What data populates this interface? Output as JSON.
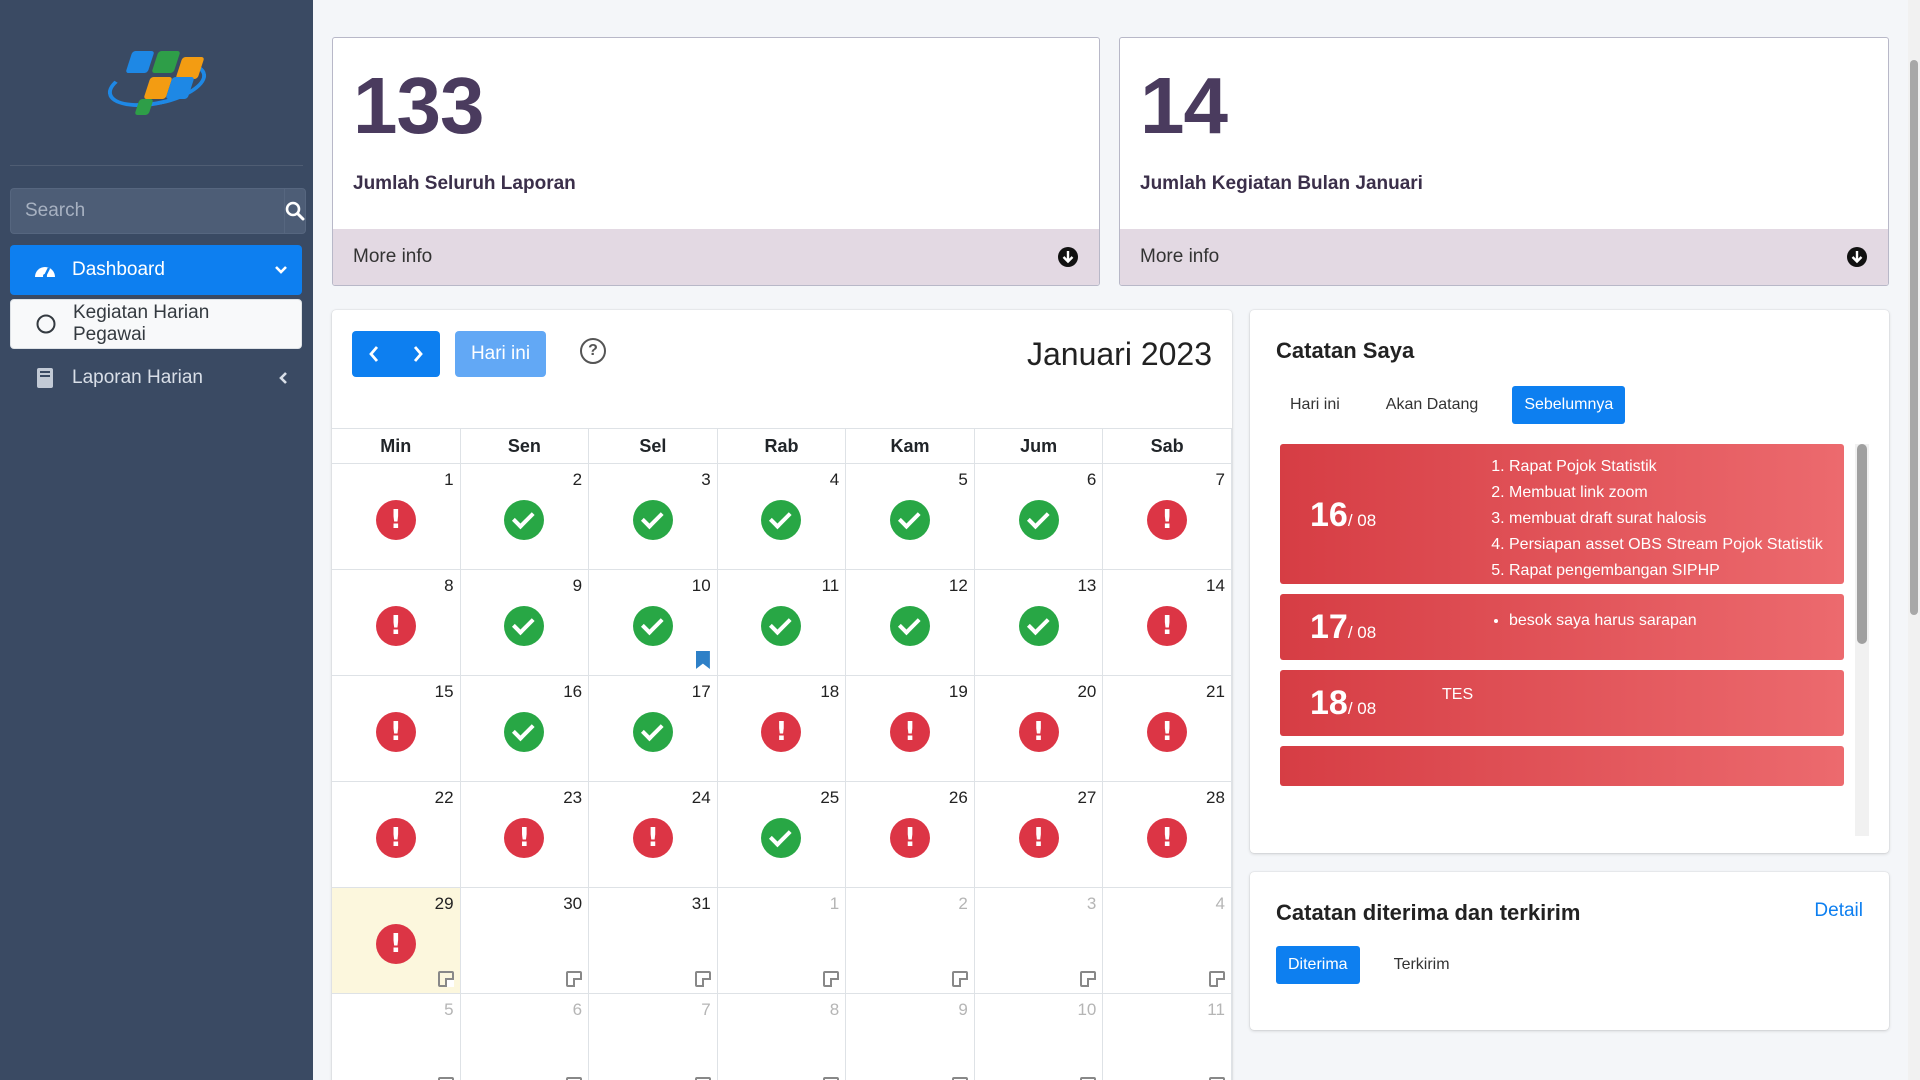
{
  "sidebar": {
    "search_placeholder": "Search",
    "items": [
      {
        "label": "Dashboard",
        "icon": "tachometer-icon"
      },
      {
        "label": "Kegiatan Harian Pegawai",
        "icon": "circle-icon"
      },
      {
        "label": "Laporan Harian",
        "icon": "book-icon"
      }
    ]
  },
  "info_boxes": [
    {
      "number": "133",
      "label": "Jumlah Seluruh Laporan",
      "more": "More info"
    },
    {
      "number": "14",
      "label": "Jumlah Kegiatan Bulan Januari",
      "more": "More info"
    }
  ],
  "calendar": {
    "title": "Januari 2023",
    "today_label": "Hari ini",
    "days": [
      "Min",
      "Sen",
      "Sel",
      "Rab",
      "Kam",
      "Jum",
      "Sab"
    ],
    "weeks": [
      [
        {
          "d": "1",
          "s": "bad"
        },
        {
          "d": "2",
          "s": "ok"
        },
        {
          "d": "3",
          "s": "ok"
        },
        {
          "d": "4",
          "s": "ok"
        },
        {
          "d": "5",
          "s": "ok"
        },
        {
          "d": "6",
          "s": "ok"
        },
        {
          "d": "7",
          "s": "bad"
        }
      ],
      [
        {
          "d": "8",
          "s": "bad"
        },
        {
          "d": "9",
          "s": "ok"
        },
        {
          "d": "10",
          "s": "ok",
          "bookmark": true
        },
        {
          "d": "11",
          "s": "ok"
        },
        {
          "d": "12",
          "s": "ok"
        },
        {
          "d": "13",
          "s": "ok"
        },
        {
          "d": "14",
          "s": "bad"
        }
      ],
      [
        {
          "d": "15",
          "s": "bad"
        },
        {
          "d": "16",
          "s": "ok"
        },
        {
          "d": "17",
          "s": "ok"
        },
        {
          "d": "18",
          "s": "bad"
        },
        {
          "d": "19",
          "s": "bad"
        },
        {
          "d": "20",
          "s": "bad"
        },
        {
          "d": "21",
          "s": "bad"
        }
      ],
      [
        {
          "d": "22",
          "s": "bad"
        },
        {
          "d": "23",
          "s": "bad"
        },
        {
          "d": "24",
          "s": "bad"
        },
        {
          "d": "25",
          "s": "ok"
        },
        {
          "d": "26",
          "s": "bad"
        },
        {
          "d": "27",
          "s": "bad"
        },
        {
          "d": "28",
          "s": "bad"
        }
      ],
      [
        {
          "d": "29",
          "s": "bad",
          "today": true,
          "note": true
        },
        {
          "d": "30",
          "note": true
        },
        {
          "d": "31",
          "note": true
        },
        {
          "d": "1",
          "other": true,
          "note": true
        },
        {
          "d": "2",
          "other": true,
          "note": true
        },
        {
          "d": "3",
          "other": true,
          "note": true
        },
        {
          "d": "4",
          "other": true,
          "note": true
        }
      ],
      [
        {
          "d": "5",
          "other": true,
          "note": true
        },
        {
          "d": "6",
          "other": true,
          "note": true
        },
        {
          "d": "7",
          "other": true,
          "note": true
        },
        {
          "d": "8",
          "other": true,
          "note": true
        },
        {
          "d": "9",
          "other": true,
          "note": true
        },
        {
          "d": "10",
          "other": true,
          "note": true
        },
        {
          "d": "11",
          "other": true,
          "note": true
        }
      ]
    ]
  },
  "catatan_saya": {
    "title": "Catatan Saya",
    "tabs": [
      "Hari ini",
      "Akan Datang",
      "Sebelumnya"
    ],
    "active_tab": "Sebelumnya",
    "notes": [
      {
        "day": "16",
        "month": "/ 08",
        "type": "ol",
        "items": [
          "Rapat Pojok Statistik",
          "Membuat link zoom",
          "membuat draft surat halosis",
          "Persiapan asset OBS Stream Pojok Statistik",
          "Rapat pengembangan SIPHP"
        ]
      },
      {
        "day": "17",
        "month": "/ 08",
        "type": "ul",
        "items": [
          "besok saya harus sarapan"
        ]
      },
      {
        "day": "18",
        "month": "/ 08",
        "type": "text",
        "text": "TES"
      }
    ]
  },
  "catatan_terima": {
    "title": "Catatan diterima dan terkirim",
    "detail": "Detail",
    "tabs": [
      "Diterima",
      "Terkirim"
    ],
    "active_tab": "Diterima"
  },
  "colors": {
    "primary": "#0d7ff0",
    "success": "#28a745",
    "danger": "#dc3545",
    "sidebar": "#3a4a63"
  }
}
